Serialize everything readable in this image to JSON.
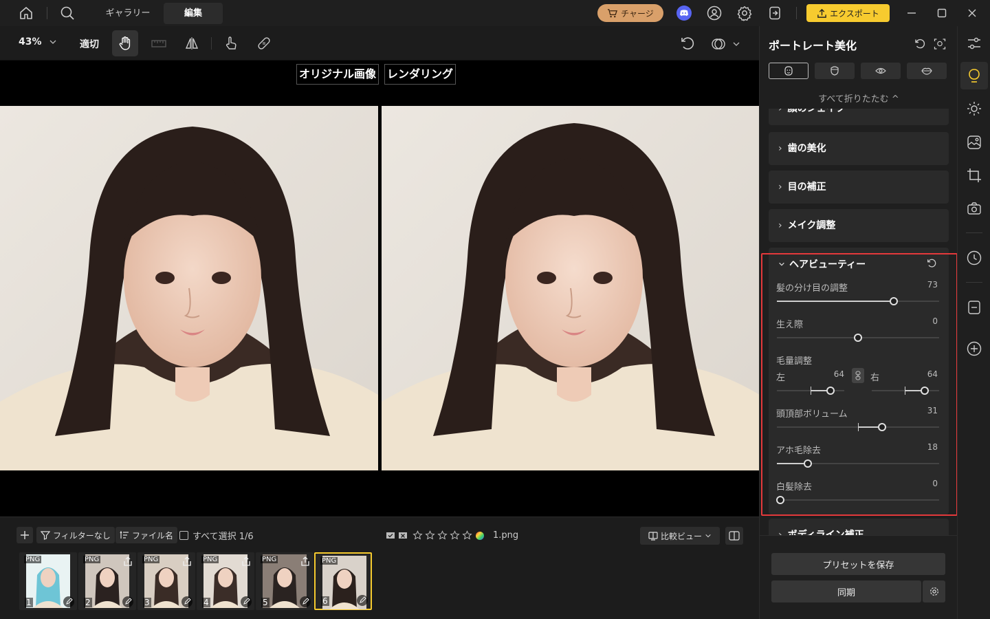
{
  "titlebar": {
    "tabs": [
      "ギャラリー",
      "編集"
    ],
    "charge_label": "チャージ",
    "export_label": "エクスポート"
  },
  "toolbar": {
    "zoom": "43%",
    "fit_label": "適切"
  },
  "canvas": {
    "original_label": "オリジナル画像",
    "rendered_label": "レンダリング"
  },
  "filmstrip": {
    "filter_label": "フィルターなし",
    "sort_label": "ファイル名",
    "select_all_label": "すべて選択 1/6",
    "filename": "1.png",
    "compare_view_label": "比較ビュー",
    "thumbs": [
      {
        "badge": "PNG",
        "num": "1"
      },
      {
        "badge": "PNG",
        "num": "2"
      },
      {
        "badge": "PNG",
        "num": "3"
      },
      {
        "badge": "PNG",
        "num": "4"
      },
      {
        "badge": "PNG",
        "num": "5"
      },
      {
        "badge": "PNG",
        "num": "6"
      }
    ],
    "rating": 0
  },
  "panel": {
    "title": "ポートレート美化",
    "collapse_all": "すべて折りたたむ ^",
    "sections": {
      "face_partial": "顔のシェイプ",
      "teeth": "歯の美化",
      "eyes": "目の補正",
      "makeup": "メイク調整",
      "hair": "ヘアビューティー",
      "body": "ボディライン補正"
    },
    "hair_sliders": {
      "part": {
        "label": "髪の分け目の調整",
        "value": "73"
      },
      "hairline": {
        "label": "生え際",
        "value": "0"
      },
      "volume_title": "毛量調整",
      "left": {
        "label": "左",
        "value": "64"
      },
      "right": {
        "label": "右",
        "value": "64"
      },
      "crown": {
        "label": "頭頂部ボリューム",
        "value": "31"
      },
      "flyaway": {
        "label": "アホ毛除去",
        "value": "18"
      },
      "gray": {
        "label": "白髪除去",
        "value": "0"
      }
    },
    "save_preset": "プリセットを保存",
    "sync": "同期"
  },
  "colors": {
    "accent": "#f7cb2f",
    "highlight_border": "#e5393b",
    "charge": "#d9a06a"
  }
}
